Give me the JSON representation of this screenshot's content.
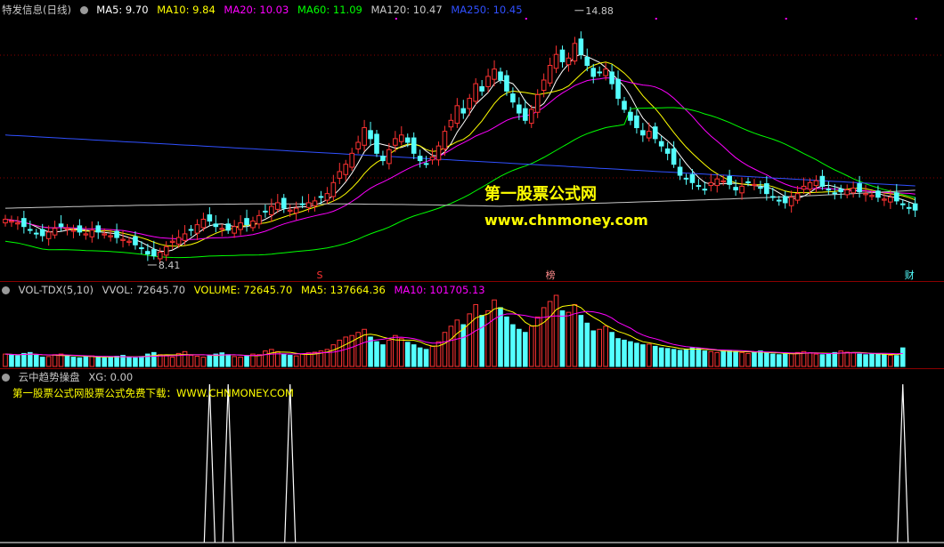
{
  "header_price": {
    "title": "特发信息(日线)",
    "ma": [
      {
        "label": "MA5: 9.70",
        "color": "#ffffff"
      },
      {
        "label": "MA10: 9.84",
        "color": "#ffff00"
      },
      {
        "label": "MA20: 10.03",
        "color": "#ff00ff"
      },
      {
        "label": "MA60: 11.09",
        "color": "#00ff00"
      },
      {
        "label": "MA120: 10.47",
        "color": "#c8c8c8"
      },
      {
        "label": "MA250: 10.45",
        "color": "#3050ff"
      }
    ]
  },
  "header_volume": {
    "title": "VOL-TDX(5,10)",
    "items": [
      {
        "label": "VVOL: 72645.70",
        "color": "#c8c8c8"
      },
      {
        "label": "VOLUME: 72645.70",
        "color": "#ffff00"
      },
      {
        "label": "MA5: 137664.36",
        "color": "#ffff00"
      },
      {
        "label": "MA10: 101705.13",
        "color": "#ff00ff"
      }
    ]
  },
  "header_indicator": {
    "title": "云中趋势操盘",
    "xg": "XG: 0.00",
    "note": "第一股票公式网股票公式免费下载：WWW.CHNMONEY.COM"
  },
  "watermark": {
    "line1": "第一股票公式网",
    "line2": "www.chnmoney.com"
  },
  "colors": {
    "up": "#ff3232",
    "down": "#54ffff",
    "bg": "#000000",
    "grid": "#8b0000"
  },
  "chart_data": [
    {
      "type": "candlestick",
      "title": "特发信息(日线)",
      "annotations": [
        {
          "label": "14.88",
          "kind": "high",
          "bar": 92
        },
        {
          "label": "8.41",
          "kind": "low",
          "bar": 23
        }
      ],
      "markers": [
        {
          "label": "S",
          "bar": 51,
          "color": "#ff3232"
        },
        {
          "label": "榜",
          "bar": 88,
          "color": "#ff8c8c"
        },
        {
          "label": "财",
          "bar": 146,
          "color": "#54ffff"
        }
      ],
      "closes": [
        9.5,
        9.45,
        9.4,
        9.3,
        9.2,
        9.1,
        9.05,
        9.15,
        9.25,
        9.3,
        9.25,
        9.2,
        9.15,
        9.1,
        9.2,
        9.15,
        9.1,
        9.05,
        9.0,
        8.95,
        8.9,
        8.8,
        8.7,
        8.55,
        8.5,
        8.6,
        8.75,
        8.9,
        9.0,
        9.1,
        9.2,
        9.35,
        9.5,
        9.45,
        9.3,
        9.25,
        9.2,
        9.3,
        9.4,
        9.35,
        9.45,
        9.6,
        9.7,
        9.85,
        9.95,
        9.8,
        9.75,
        9.8,
        9.9,
        9.95,
        10.0,
        10.1,
        10.2,
        10.5,
        10.8,
        11.0,
        11.3,
        11.6,
        12.0,
        11.7,
        11.3,
        11.1,
        11.4,
        11.7,
        11.8,
        11.6,
        11.3,
        11.1,
        11.0,
        11.2,
        11.5,
        11.9,
        12.2,
        12.6,
        12.4,
        12.8,
        13.2,
        13.0,
        13.4,
        13.6,
        13.3,
        13.0,
        12.7,
        12.4,
        12.2,
        12.5,
        12.9,
        13.3,
        13.7,
        14.0,
        13.8,
        13.9,
        14.3,
        14.0,
        13.7,
        13.4,
        13.5,
        13.6,
        13.2,
        12.8,
        12.5,
        12.2,
        12.0,
        11.8,
        11.9,
        11.7,
        11.5,
        11.3,
        11.0,
        10.7,
        10.6,
        10.5,
        10.4,
        10.3,
        10.5,
        10.6,
        10.55,
        10.45,
        10.3,
        10.4,
        10.5,
        10.45,
        10.35,
        10.2,
        10.1,
        10.0,
        9.95,
        10.1,
        10.2,
        10.4,
        10.5,
        10.55,
        10.4,
        10.3,
        10.2,
        10.25,
        10.3,
        10.35,
        10.25,
        10.2,
        10.15,
        10.1,
        10.05,
        10.1,
        10.0,
        9.9,
        9.8,
        9.75
      ],
      "ma_series_names": [
        "MA5",
        "MA10",
        "MA20",
        "MA60",
        "MA120",
        "MA250"
      ],
      "low_label": "8.41",
      "high_label": "14.88"
    },
    {
      "type": "bar",
      "title": "VOL-TDX(5,10)",
      "series": [
        {
          "name": "VOLUME",
          "values": [
            40,
            38,
            35,
            42,
            45,
            36,
            30,
            32,
            38,
            40,
            35,
            30,
            28,
            32,
            34,
            30,
            28,
            30,
            33,
            36,
            30,
            28,
            32,
            40,
            45,
            38,
            34,
            30,
            42,
            48,
            36,
            33,
            30,
            35,
            40,
            44,
            38,
            32,
            30,
            34,
            40,
            38,
            50,
            55,
            48,
            40,
            36,
            34,
            40,
            44,
            46,
            50,
            55,
            70,
            85,
            95,
            100,
            110,
            120,
            95,
            80,
            70,
            85,
            100,
            90,
            78,
            70,
            60,
            55,
            65,
            80,
            110,
            130,
            150,
            135,
            170,
            200,
            165,
            180,
            215,
            190,
            160,
            135,
            120,
            110,
            130,
            160,
            190,
            210,
            230,
            180,
            175,
            200,
            165,
            140,
            115,
            120,
            130,
            110,
            90,
            85,
            80,
            75,
            70,
            72,
            65,
            60,
            58,
            55,
            52,
            55,
            60,
            58,
            50,
            48,
            45,
            50,
            52,
            48,
            45,
            42,
            46,
            50,
            44,
            40,
            38,
            40,
            42,
            45,
            48,
            44,
            40,
            38,
            42,
            45,
            50,
            46,
            44,
            40,
            38,
            42,
            40,
            38,
            36,
            35,
            60
          ]
        }
      ],
      "ylim": [
        0,
        230
      ]
    },
    {
      "type": "line",
      "title": "云中趋势操盘",
      "series": [
        {
          "name": "XG",
          "values": "spikes at bars 33, 36, 46, 145"
        }
      ]
    }
  ]
}
